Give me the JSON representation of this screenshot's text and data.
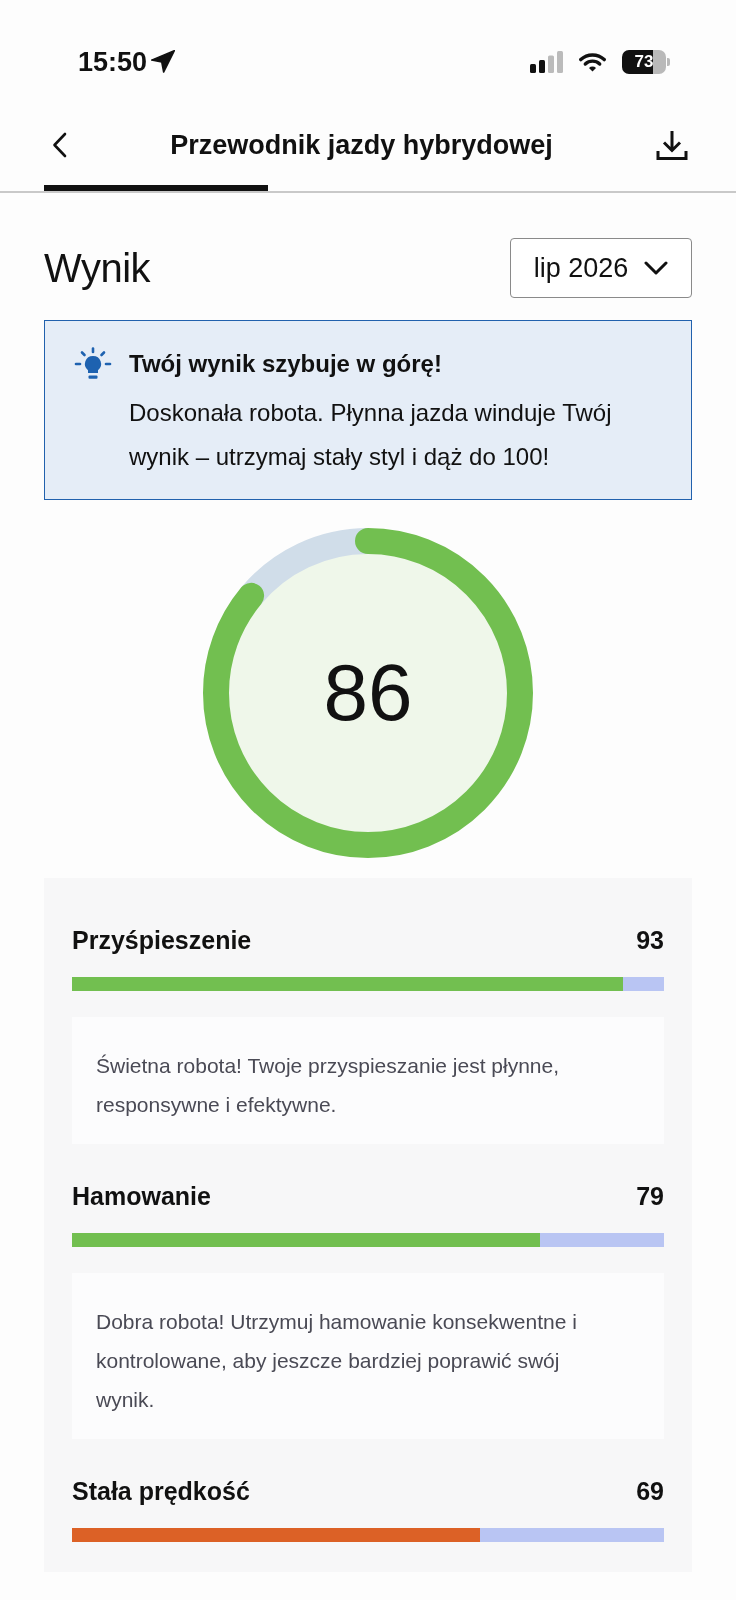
{
  "status_bar": {
    "time": "15:50",
    "battery": "73"
  },
  "header": {
    "title": "Przewodnik jazdy hybrydowej"
  },
  "score": {
    "heading": "Wynik",
    "period": "lip 2026",
    "value": "86",
    "level": 0.86
  },
  "tip": {
    "title": "Twój wynik szybuje w górę!",
    "text": "Doskonała robota. Płynna jazda winduje Twój wynik – utrzymaj stały styl i dąż do 100!"
  },
  "categories": [
    {
      "name": "Przyśpieszenie",
      "value": "93",
      "level": 0.93,
      "color": "#72bf50",
      "description": "Świetna robota! Twoje przyspieszanie jest płynne, responsywne i efektywne."
    },
    {
      "name": "Hamowanie",
      "value": "79",
      "level": 0.79,
      "color": "#72bf50",
      "description": "Dobra robota! Utrzymuj hamowanie konsekwentne i kontrolowane, aby jeszcze bardziej poprawić swój wynik."
    },
    {
      "name": "Stała prędkość",
      "value": "69",
      "level": 0.69,
      "color": "#dc6126"
    }
  ]
}
